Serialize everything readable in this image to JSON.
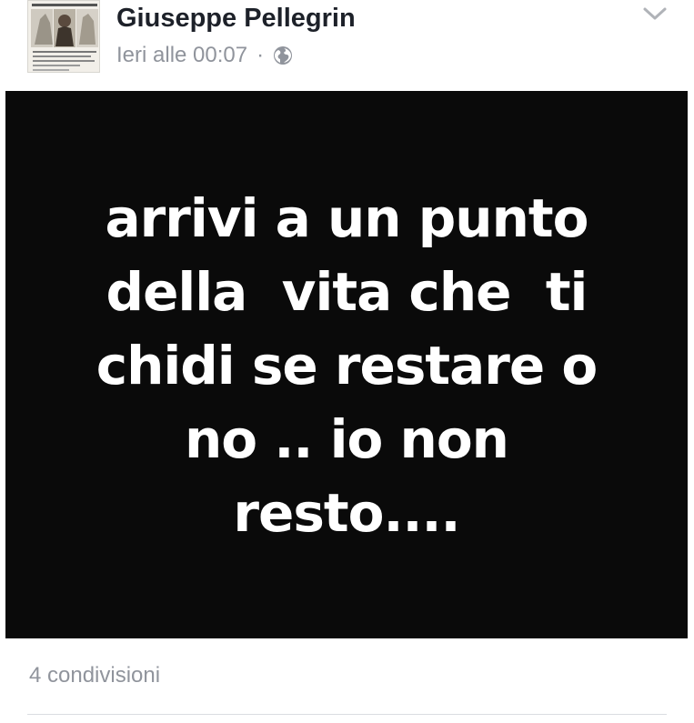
{
  "post": {
    "author": "Giuseppe Pellegrin",
    "timestamp": "Ieri alle 00:07",
    "separator": "·",
    "privacy_icon": "globe-icon",
    "menu_icon": "chevron-down-icon",
    "image_text": "arrivi a un punto\ndella  vita che  ti\nchidi se restare o\nno .. io non\nresto....",
    "shares": "4 condivisioni"
  },
  "colors": {
    "name": "#1d2129",
    "meta": "#90949c",
    "image_bg": "#0a0a0a",
    "image_text": "#ffffff",
    "divider": "#dadde1"
  }
}
